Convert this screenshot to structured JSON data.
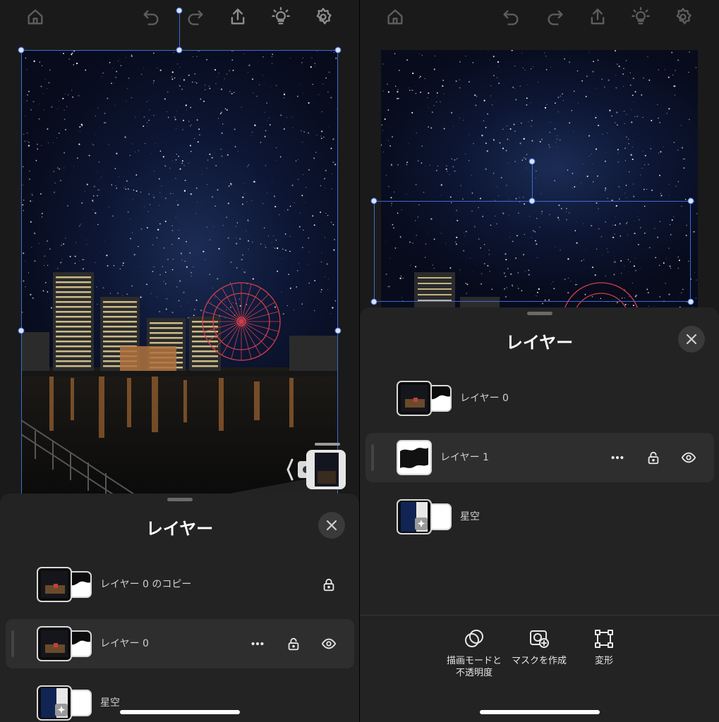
{
  "left": {
    "toolbar": {
      "home_icon": "home-icon",
      "undo_icon": "undo-icon",
      "redo_icon": "redo-icon",
      "share_icon": "share-icon",
      "tips_icon": "lightbulb-icon",
      "settings_icon": "gear-icon"
    },
    "layers_sheet": {
      "title": "レイヤー",
      "layers": [
        {
          "name": "レイヤー 0 のコピー",
          "locked": true,
          "selected": false
        },
        {
          "name": "レイヤー 0",
          "locked": false,
          "selected": true
        },
        {
          "name": "星空",
          "locked": false,
          "selected": false
        }
      ]
    }
  },
  "right": {
    "layers_sheet": {
      "title": "レイヤー",
      "layers": [
        {
          "name": "レイヤー 0",
          "selected": false
        },
        {
          "name": "レイヤー 1",
          "selected": true
        },
        {
          "name": "星空",
          "selected": false
        }
      ]
    },
    "bottom_tools": [
      {
        "label": "描画モードと\n不透明度",
        "icon": "blend-mode-icon"
      },
      {
        "label": "マスクを作成",
        "icon": "create-mask-icon"
      },
      {
        "label": "変形",
        "icon": "transform-icon"
      }
    ]
  },
  "colors": {
    "background": "#1a1a1a",
    "sheet": "#232323",
    "selection_handle": "#3d6bd3",
    "selected_row": "#2e2e2e"
  }
}
